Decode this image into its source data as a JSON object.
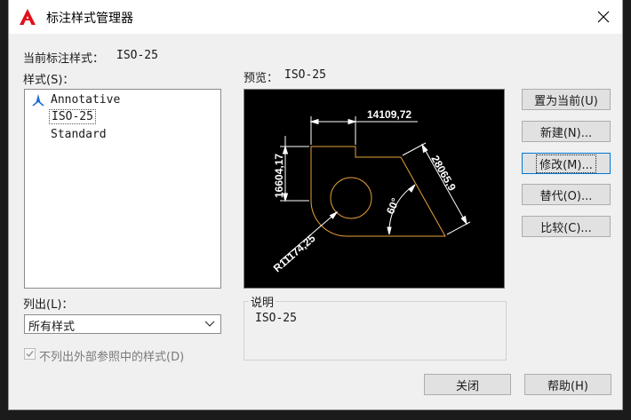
{
  "window": {
    "title": "标注样式管理器",
    "close_glyph": "✕",
    "app_icon": "autocad-logo-icon"
  },
  "current_style": {
    "label": "当前标注样式：",
    "value": "ISO-25"
  },
  "styles": {
    "label": "样式(S)：",
    "items": [
      {
        "name": "Annotative",
        "icon": "annotative-icon"
      },
      {
        "name": "ISO-25",
        "selected": true
      },
      {
        "name": "Standard"
      }
    ]
  },
  "preview": {
    "label": "预览：",
    "style_name": "ISO-25",
    "dimensions": {
      "top": "14109,72",
      "left": "16604,17",
      "aligned": "28065,9",
      "angle": "60°",
      "radius": "R11174,25"
    }
  },
  "list_filter": {
    "label": "列出(L)：",
    "selected": "所有样式"
  },
  "xref_checkbox": {
    "label": "不列出外部参照中的样式(D)",
    "checked": true,
    "disabled": true
  },
  "description": {
    "label": "说明",
    "text": "ISO-25"
  },
  "buttons": {
    "set_current": "置为当前(U)",
    "new": "新建(N)...",
    "modify": "修改(M)...",
    "override": "替代(O)...",
    "compare": "比较(C)...",
    "close": "关闭",
    "help": "帮助(H)"
  },
  "colors": {
    "accent": "#0078d7",
    "geometry": "#e8a23a",
    "dimension": "#ffffff",
    "title_icon": "#e0101c"
  }
}
